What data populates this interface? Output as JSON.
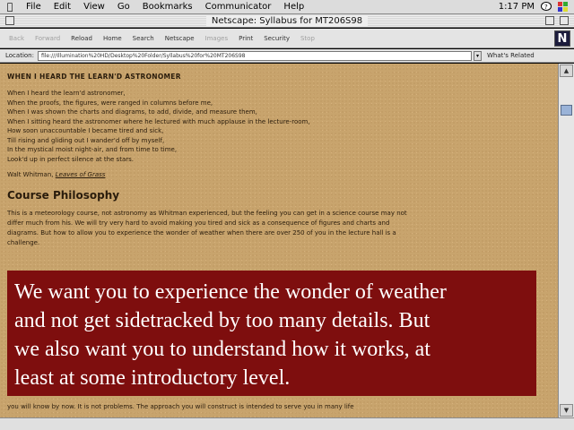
{
  "menubar": {
    "apple_glyph": "",
    "items": [
      "File",
      "Edit",
      "View",
      "Go",
      "Bookmarks",
      "Communicator",
      "Help"
    ],
    "clock": "1:17 PM"
  },
  "window": {
    "title": "Netscape: Syllabus for MT206S98"
  },
  "toolbar": {
    "buttons": [
      {
        "label": "Back",
        "enabled": false
      },
      {
        "label": "Forward",
        "enabled": false
      },
      {
        "label": "Reload",
        "enabled": true
      },
      {
        "label": "Home",
        "enabled": true
      },
      {
        "label": "Search",
        "enabled": true
      },
      {
        "label": "Netscape",
        "enabled": true
      },
      {
        "label": "Images",
        "enabled": false
      },
      {
        "label": "Print",
        "enabled": true
      },
      {
        "label": "Security",
        "enabled": true
      },
      {
        "label": "Stop",
        "enabled": false
      }
    ],
    "logo": "N"
  },
  "location": {
    "label": "Location:",
    "url": "file:///Illumination%20HD/Desktop%20Folder/Syllabus%20for%20MT206S98",
    "whats_related": "What's Related"
  },
  "page": {
    "poem_title": "WHEN I HEARD THE LEARN'D ASTRONOMER",
    "poem_lines": [
      "When I heard the learn'd astronomer,",
      "When the proofs, the figures, were ranged in columns before me,",
      "When I was shown the charts and diagrams, to add, divide, and measure them,",
      "When I sitting heard the astronomer where he lectured with much applause in the lecture-room,",
      "How soon unaccountable I became tired and sick,",
      "Till rising and gliding out I wander'd off by myself,",
      "In the mystical moist night-air, and from time to time,",
      "Look'd up in perfect silence at the stars."
    ],
    "attribution_prefix": "Walt Whitman,",
    "attribution_link": "Leaves of Grass",
    "section_heading": "Course Philosophy",
    "paragraph_lines": [
      "This is a meteorology course, not astronomy as Whitman experienced, but the feeling you can get in a science course may not",
      "differ much from his. We will try very hard to avoid making you tired and sick as a consequence of figures and charts and",
      "diagrams. But how to allow you to experience the wonder of weather when there are over 250 of you in the lecture hall is a",
      "challenge."
    ],
    "bottom_line": "you will know by now. It is not problems. The approach you will construct is intended to serve you in many life"
  },
  "caption": {
    "lines": [
      "We want you to experience the wonder of weather",
      "and not get sidetracked by too many details. But",
      "we also want you to understand how it works, at",
      "least at some introductory level."
    ]
  }
}
